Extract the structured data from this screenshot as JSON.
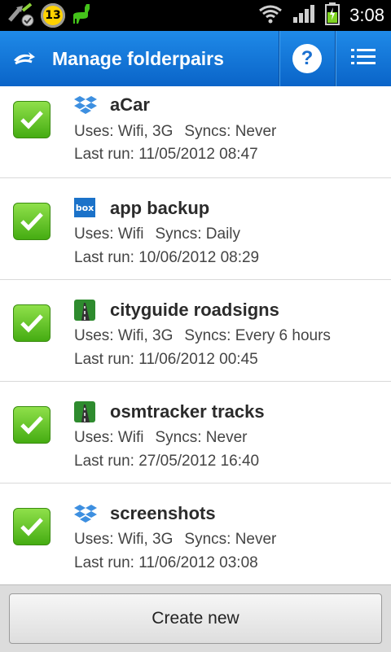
{
  "status_bar": {
    "notification_count": "13",
    "time": "3:08",
    "icons": [
      "sync-icon",
      "notification-badge",
      "llama-icon",
      "wifi-icon",
      "signal-icon",
      "battery-icon"
    ]
  },
  "action_bar": {
    "title": "Manage folderpairs",
    "help_label": "?",
    "colors": {
      "background": "#1478dc"
    }
  },
  "folderpairs": [
    {
      "name": "aCar",
      "service_icon": "dropbox-icon",
      "uses": "Uses: Wifi, 3G",
      "syncs": "Syncs: Never",
      "last_run": "Last run: 11/05/2012 08:47",
      "enabled": true
    },
    {
      "name": "app backup",
      "service_icon": "box-icon",
      "uses": "Uses: Wifi",
      "syncs": "Syncs: Daily",
      "last_run": "Last run: 10/06/2012 08:29",
      "enabled": true
    },
    {
      "name": "cityguide roadsigns",
      "service_icon": "road-icon",
      "uses": "Uses: Wifi, 3G",
      "syncs": "Syncs: Every 6 hours",
      "last_run": "Last run: 11/06/2012 00:45",
      "enabled": true
    },
    {
      "name": "osmtracker tracks",
      "service_icon": "road-icon",
      "uses": "Uses: Wifi",
      "syncs": "Syncs: Never",
      "last_run": "Last run: 27/05/2012 16:40",
      "enabled": true
    },
    {
      "name": "screenshots",
      "service_icon": "dropbox-icon",
      "uses": "Uses: Wifi, 3G",
      "syncs": "Syncs: Never",
      "last_run": "Last run: 11/06/2012 03:08",
      "enabled": true
    }
  ],
  "bottom": {
    "create_label": "Create new"
  }
}
